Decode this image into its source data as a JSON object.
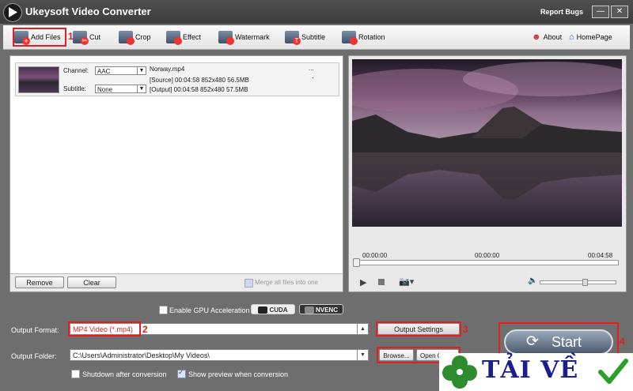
{
  "app": {
    "title": "Ukeysoft Video Converter",
    "report_bugs": "Report Bugs"
  },
  "toolbar": {
    "add_files": "Add Files",
    "cut": "Cut",
    "crop": "Crop",
    "effect": "Effect",
    "watermark": "Watermark",
    "subtitle": "Subtitle",
    "rotation": "Rotation",
    "about": "About",
    "homepage": "HomePage"
  },
  "annotations": {
    "n1": "1",
    "n2": "2",
    "n3": "3",
    "n4": "4"
  },
  "file": {
    "channel_label": "Channel:",
    "channel_value": "AAC",
    "subtitle_label": "Subtitle:",
    "subtitle_value": "None",
    "name": "Norway.mp4",
    "ellipsis": "...",
    "dash": "-",
    "source": "[Source]  00:04:58  852x480  56.5MB",
    "output": "[Output]  00:04:58  852x480  57.5MB"
  },
  "list_actions": {
    "remove": "Remove",
    "clear": "Clear",
    "merge": "Merge all files into one"
  },
  "player": {
    "time_start": "00:00:00",
    "time_mid": "00:00:00",
    "time_end": "00:04:58",
    "volume_level": 0.6
  },
  "gpu": {
    "label": "Enable GPU Acceleration",
    "cuda": "CUDA",
    "nvenc": "NVENC"
  },
  "output": {
    "format_label": "Output Format:",
    "format_value": "MP4 Video (*.mp4)",
    "settings_button": "Output Settings",
    "folder_label": "Output Folder:",
    "folder_value": "C:\\Users\\Administrator\\Desktop\\My Videos\\",
    "browse_button": "Browse...",
    "open_button": "Open O",
    "shutdown_label": "Shutdown after conversion",
    "preview_label": "Show preview when conversion"
  },
  "start": {
    "label": "Start"
  },
  "watermark": {
    "text": "TẢI VỀ"
  }
}
